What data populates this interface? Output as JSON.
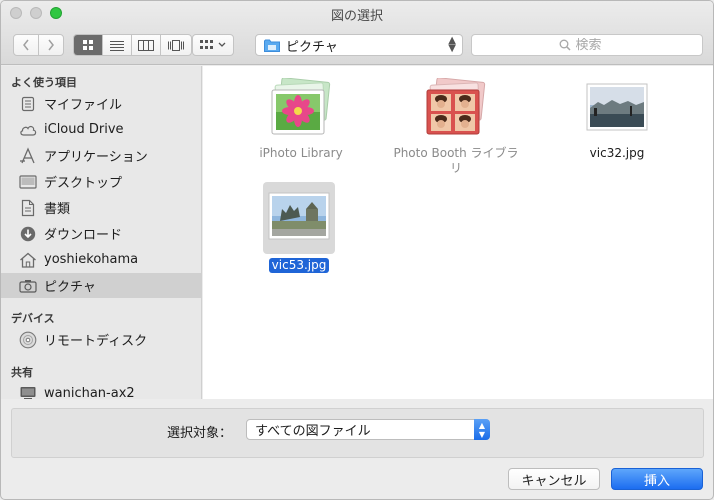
{
  "window": {
    "title": "図の選択"
  },
  "toolbar": {
    "back_icon": "chevron-left-icon",
    "forward_icon": "chevron-right-icon",
    "views": [
      "icon-view",
      "list-view",
      "column-view",
      "coverflow-view"
    ],
    "active_view": 0,
    "location_label": "ピクチャ",
    "search_placeholder": "検索"
  },
  "sidebar": {
    "favorites_header": "よく使う項目",
    "favorites": [
      {
        "label": "マイファイル",
        "icon": "all-files-icon"
      },
      {
        "label": "iCloud Drive",
        "icon": "cloud-icon"
      },
      {
        "label": "アプリケーション",
        "icon": "applications-icon"
      },
      {
        "label": "デスクトップ",
        "icon": "desktop-icon"
      },
      {
        "label": "書類",
        "icon": "documents-icon"
      },
      {
        "label": "ダウンロード",
        "icon": "downloads-icon"
      },
      {
        "label": "yoshiekohama",
        "icon": "home-icon"
      },
      {
        "label": "ピクチャ",
        "icon": "camera-icon",
        "selected": true
      }
    ],
    "devices_header": "デバイス",
    "devices": [
      {
        "label": "リモートディスク",
        "icon": "disc-icon"
      }
    ],
    "shared_header": "共有",
    "shared": [
      {
        "label": "wanichan-ax2",
        "icon": "computer-icon"
      }
    ]
  },
  "files": [
    {
      "name": "iPhoto Library",
      "kind": "iphoto",
      "dim": true
    },
    {
      "name": "Photo Booth ライブラリ",
      "kind": "photobooth",
      "dim": true
    },
    {
      "name": "vic32.jpg",
      "kind": "photo"
    },
    {
      "name": "vic53.jpg",
      "kind": "photo",
      "selected": true
    }
  ],
  "accessory": {
    "label": "選択対象：",
    "selected_option": "すべての図ファイル"
  },
  "buttons": {
    "cancel": "キャンセル",
    "insert": "挿入"
  },
  "colors": {
    "accent": "#1f65d7",
    "zoom_button": "#2fc741"
  }
}
